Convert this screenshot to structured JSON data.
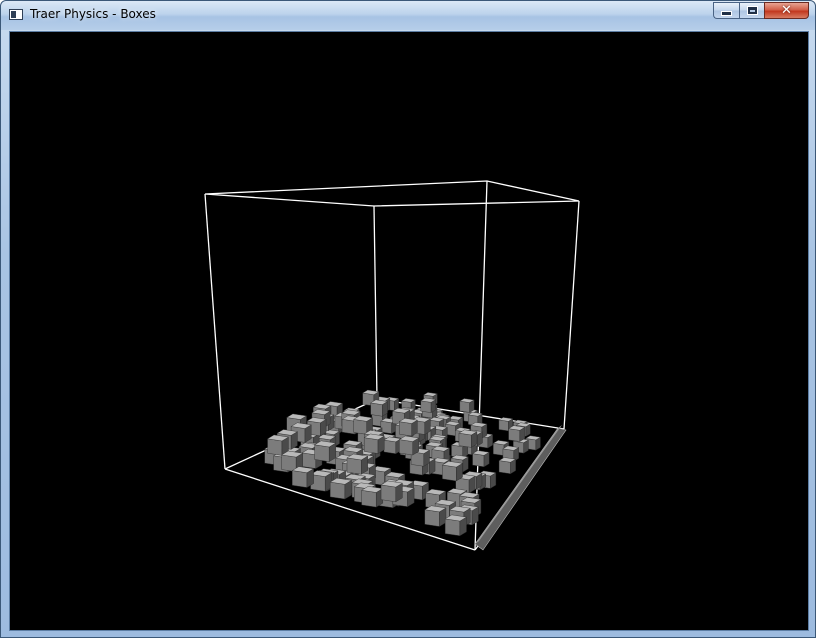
{
  "window": {
    "title": "Traer Physics - Boxes",
    "icon": "application-window-icon"
  },
  "controls": {
    "minimize_icon": "minimize-icon",
    "maximize_icon": "maximize-icon",
    "close_icon": "close-icon"
  },
  "scene": {
    "background_color": "#000000",
    "edge_color": "#ffffff",
    "box_color": "#8c8c8c"
  }
}
